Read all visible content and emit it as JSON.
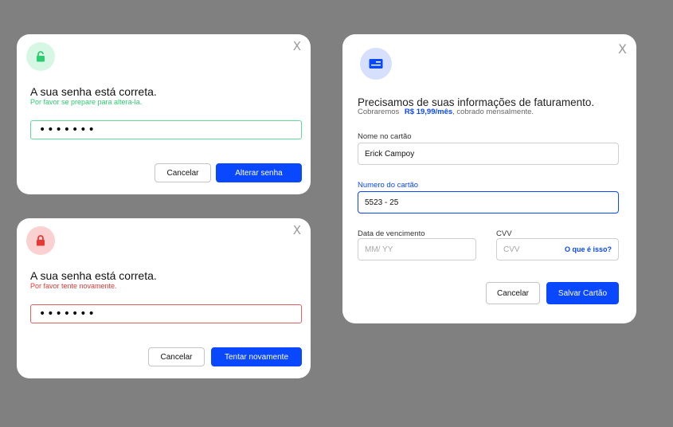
{
  "success_card": {
    "title": "A sua senha está correta.",
    "subtitle": "Por favor se prepare para altera-la.",
    "password_value": "•••••••",
    "cancel_label": "Cancelar",
    "primary_label": "Alterar senha",
    "close_label": "X",
    "accent_color": "#2ecc71"
  },
  "error_card": {
    "title": "A sua senha está correta.",
    "subtitle": "Por favor tente novamente.",
    "password_value": "•••••••",
    "cancel_label": "Cancelar",
    "primary_label": "Tentar novamente",
    "close_label": "X",
    "accent_color": "#e53935"
  },
  "billing_card": {
    "title": "Precisamos de suas informações de faturamento.",
    "subtitle_prefix": "Cobraremos",
    "price": "R$ 19,99/mês",
    "subtitle_suffix": ", cobrado mensalmente.",
    "close_label": "X",
    "name_label": "Nome no cartão",
    "name_value": "Erick Campoy",
    "number_label": "Numero do cartão",
    "number_value": "5523 - 25",
    "expiry_label": "Data de vencimento",
    "expiry_placeholder": "MM/ YY",
    "cvv_label": "CVV",
    "cvv_placeholder": "CVV",
    "cvv_help": "O que é isso?",
    "cancel_label": "Cancelar",
    "primary_label": "Salvar Cartão"
  },
  "colors": {
    "primary": "#0a48ff",
    "background": "#808080"
  }
}
